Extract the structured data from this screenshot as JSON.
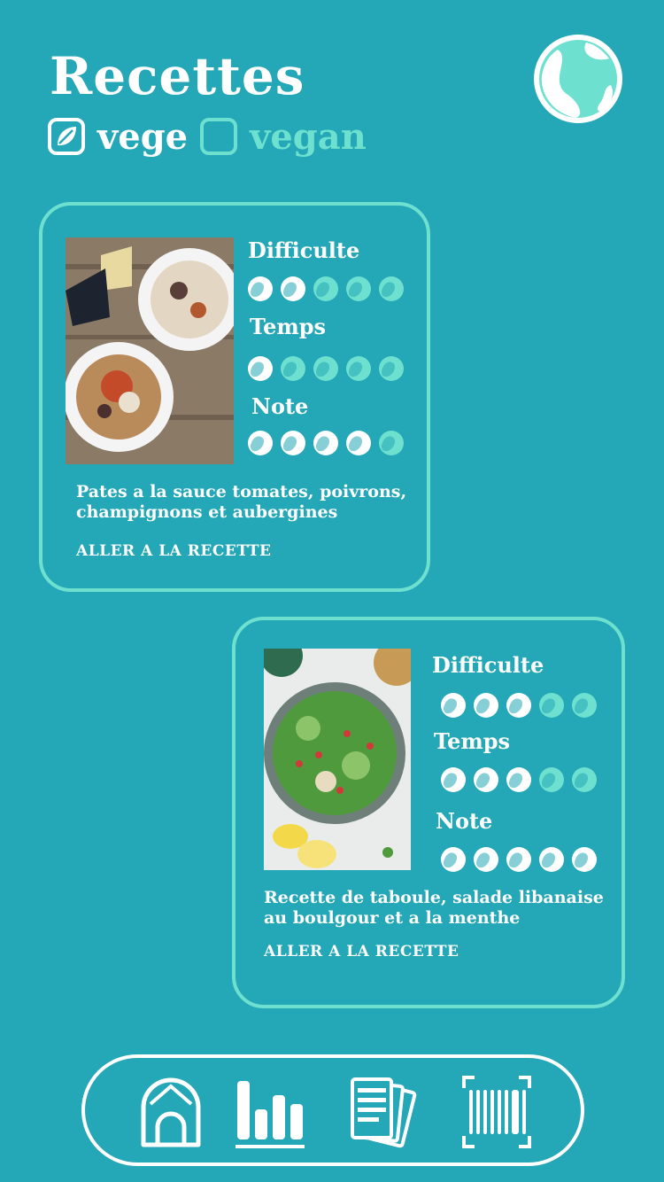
{
  "header": {
    "title": "Recettes"
  },
  "filters": [
    {
      "label": "vege",
      "checked": true
    },
    {
      "label": "vegan",
      "checked": false
    }
  ],
  "recipes": [
    {
      "image": "pasta-photo",
      "ratings": [
        {
          "label": "Difficulte",
          "value": 2,
          "max": 5
        },
        {
          "label": "Temps",
          "value": 1,
          "max": 5
        },
        {
          "label": "Note",
          "value": 4,
          "max": 5
        }
      ],
      "description": "Pates a la sauce tomates, poivrons, champignons et aubergines",
      "link": "ALLER A LA RECETTE"
    },
    {
      "image": "taboule-photo",
      "ratings": [
        {
          "label": "Difficulte",
          "value": 3,
          "max": 5
        },
        {
          "label": "Temps",
          "value": 3,
          "max": 5
        },
        {
          "label": "Note",
          "value": 5,
          "max": 5
        }
      ],
      "description": "Recette de taboule, salade libanaise au boulgour et a la menthe",
      "link": "ALLER A LA RECETTE"
    }
  ],
  "nav": [
    {
      "icon": "home-icon"
    },
    {
      "icon": "chart-icon",
      "active": true
    },
    {
      "icon": "documents-icon"
    },
    {
      "icon": "barcode-icon"
    }
  ],
  "colors": {
    "background": "#24a7b6",
    "accent": "#6de0cf",
    "foreground": "#ffffff"
  }
}
